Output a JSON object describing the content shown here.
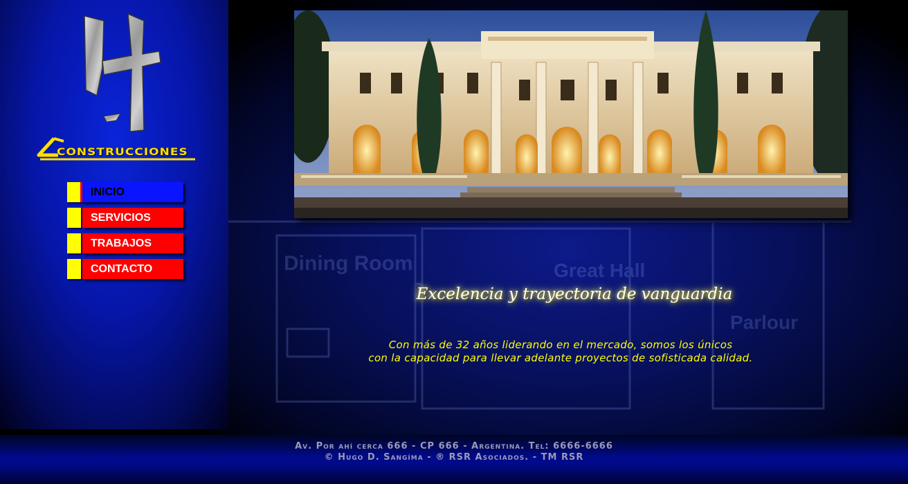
{
  "brand": {
    "logo_word": "Construcciones",
    "logo_icon": "stylized-h-logo-icon"
  },
  "menu": {
    "items": [
      {
        "label": "INICIO",
        "active": true
      },
      {
        "label": "SERVICIOS",
        "active": false
      },
      {
        "label": "TRABAJOS",
        "active": false
      },
      {
        "label": "CONTACTO",
        "active": false
      }
    ]
  },
  "hero": {
    "image": "illuminated-mansion-facade-photo"
  },
  "main": {
    "tagline": "Excelencia y trayectoria de vanguardia",
    "intro_line1": "Con más de 32 años liderando en el mercado, somos los únicos",
    "intro_line2": "con la capacidad para llevar adelante proyectos de sofisticada calidad.",
    "blueprint_labels": [
      "Dining Room",
      "Great Hall",
      "Parlour"
    ]
  },
  "footer": {
    "address": "Av. Por ahí cerca 666 - CP 666 - Argentina. Tel: 6666-6666",
    "copyright": "© Hugo D. Sangíma - ® RSR Asociados. - TM RSR"
  },
  "colors": {
    "menu_marker": "#ffff00",
    "menu_bar": "#ff0000",
    "menu_active": "#0a14ff",
    "intro_text": "#ffff00",
    "footer_text": "#9a9ab8"
  }
}
